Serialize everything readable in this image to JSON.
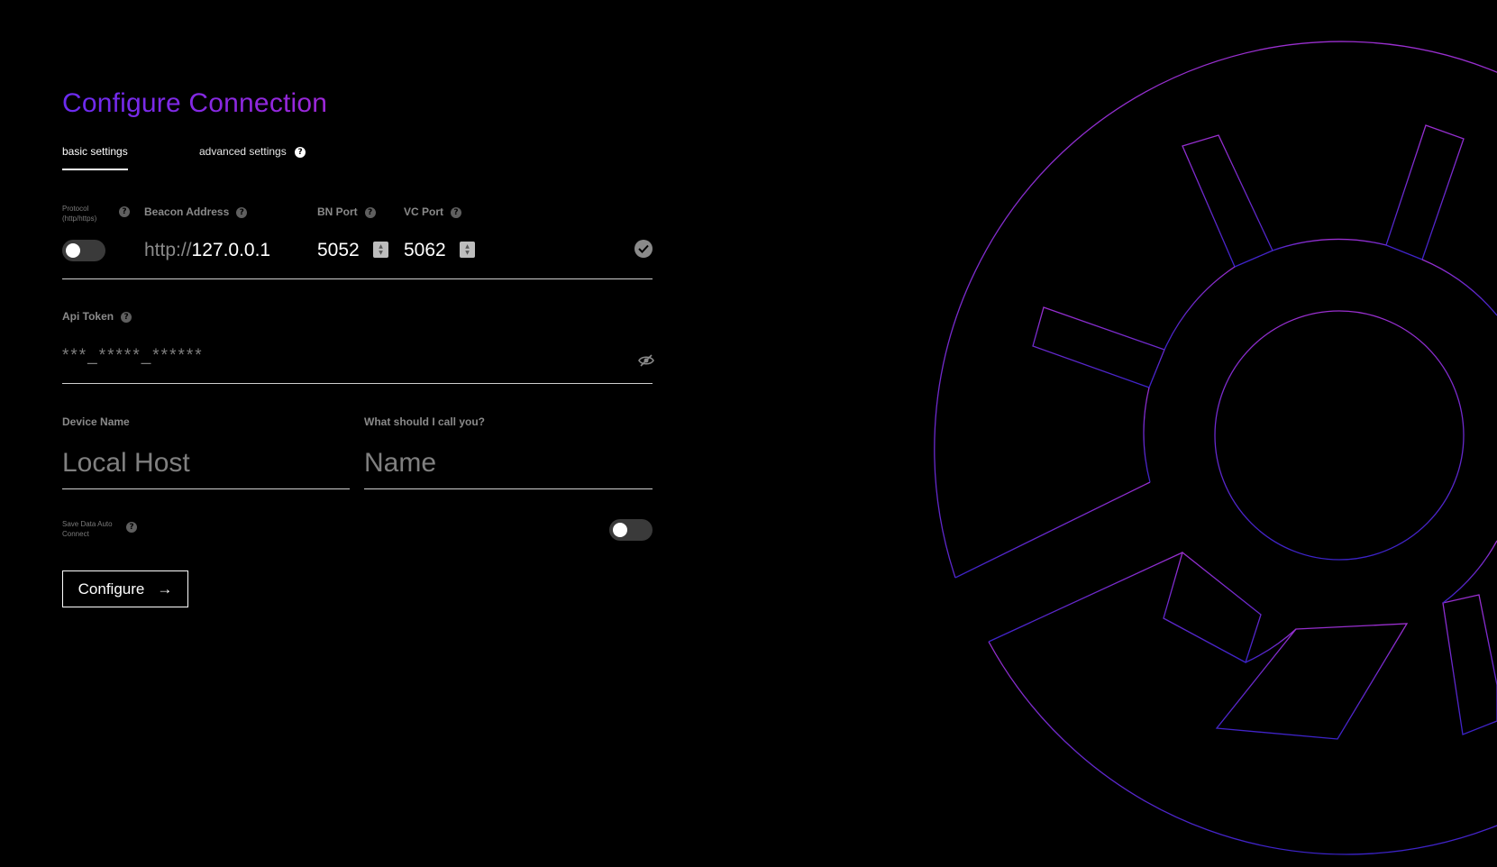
{
  "title": "Configure Connection",
  "tabs": {
    "basic": "basic settings",
    "advanced": "advanced settings"
  },
  "connection": {
    "protocol_label": "Protocol",
    "protocol_sublabel": "(http/https)",
    "protocol_on": false,
    "beacon_label": "Beacon Address",
    "beacon_prefix": "http://",
    "beacon_value": "127.0.0.1",
    "bn_port_label": "BN Port",
    "bn_port_value": "5052",
    "vc_port_label": "VC Port",
    "vc_port_value": "5062"
  },
  "api_token": {
    "label": "Api Token",
    "placeholder": "***_*****_******"
  },
  "device": {
    "label": "Device Name",
    "placeholder": "Local Host"
  },
  "username": {
    "label": "What should I call you?",
    "placeholder": "Name"
  },
  "auto_connect": {
    "label_line1": "Save Data Auto",
    "label_line2": "Connect",
    "on": false
  },
  "configure_button": "Configure",
  "colors": {
    "accent_purple": "#9d27d8",
    "accent_blue": "#4a2bd6",
    "background": "#000000"
  },
  "icons": {
    "help": "question-circle-icon",
    "check": "check-circle-icon",
    "eye": "eye-slash-icon",
    "arrow": "arrow-right-icon"
  }
}
